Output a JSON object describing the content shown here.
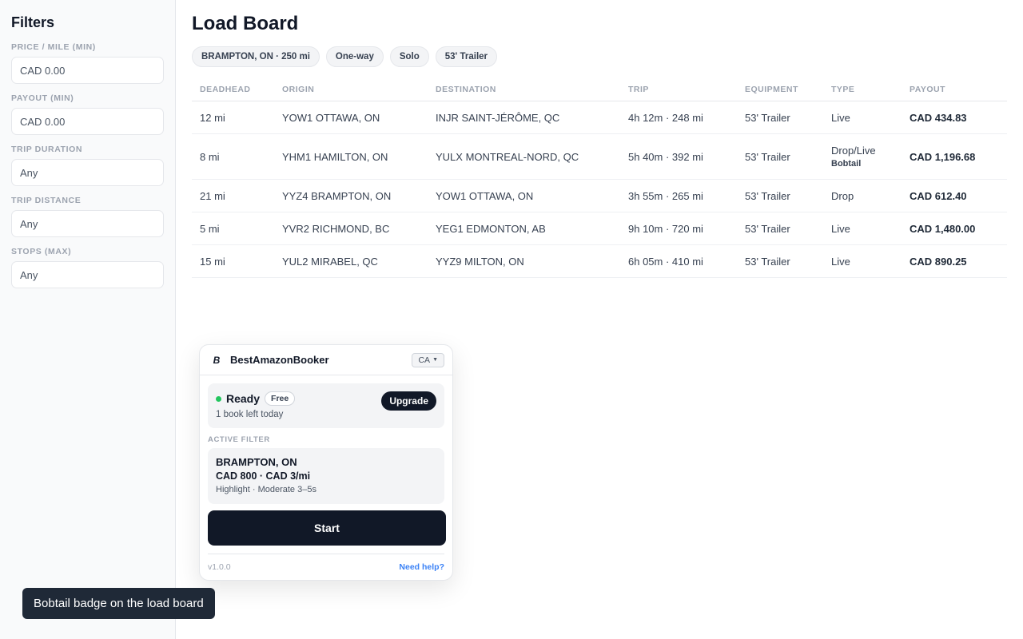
{
  "sidebar": {
    "title": "Filters",
    "filters": [
      {
        "label": "PRICE / MILE (MIN)",
        "value": "CAD 0.00"
      },
      {
        "label": "PAYOUT (MIN)",
        "value": "CAD 0.00"
      },
      {
        "label": "TRIP DURATION",
        "value": "Any"
      },
      {
        "label": "TRIP DISTANCE",
        "value": "Any"
      },
      {
        "label": "STOPS (MAX)",
        "value": "Any"
      }
    ]
  },
  "main": {
    "title": "Load Board",
    "chips": [
      "BRAMPTON, ON · 250 mi",
      "One-way",
      "Solo",
      "53' Trailer"
    ],
    "table": {
      "headers": [
        "DEADHEAD",
        "ORIGIN",
        "DESTINATION",
        "TRIP",
        "EQUIPMENT",
        "TYPE",
        "PAYOUT"
      ],
      "rows": [
        {
          "deadhead": "12 mi",
          "origin": "YOW1 OTTAWA, ON",
          "destination": "INJR SAINT-JÉRÔME, QC",
          "trip": "4h 12m · 248 mi",
          "equipment": "53' Trailer",
          "type": "Live",
          "type_sub": "",
          "payout": "CAD 434.83"
        },
        {
          "deadhead": "8 mi",
          "origin": "YHM1 HAMILTON, ON",
          "destination": "YULX MONTREAL-NORD, QC",
          "trip": "5h 40m · 392 mi",
          "equipment": "53' Trailer",
          "type": "Drop/Live",
          "type_sub": "Bobtail",
          "payout": "CAD 1,196.68"
        },
        {
          "deadhead": "21 mi",
          "origin": "YYZ4 BRAMPTON, ON",
          "destination": "YOW1 OTTAWA, ON",
          "trip": "3h 55m · 265 mi",
          "equipment": "53' Trailer",
          "type": "Drop",
          "type_sub": "",
          "payout": "CAD 612.40"
        },
        {
          "deadhead": "5 mi",
          "origin": "YVR2 RICHMOND, BC",
          "destination": "YEG1 EDMONTON, AB",
          "trip": "9h 10m · 720 mi",
          "equipment": "53' Trailer",
          "type": "Live",
          "type_sub": "",
          "payout": "CAD 1,480.00"
        },
        {
          "deadhead": "15 mi",
          "origin": "YUL2 MIRABEL, QC",
          "destination": "YYZ9 MILTON, ON",
          "trip": "6h 05m · 410 mi",
          "equipment": "53' Trailer",
          "type": "Live",
          "type_sub": "",
          "payout": "CAD 890.25"
        }
      ]
    }
  },
  "popup": {
    "brand_icon": "B",
    "brand_name": "BestAmazonBooker",
    "region": "CA",
    "status": "Ready",
    "status_color": "#22c55e",
    "plan": "Free",
    "books_left": "1 book left today",
    "upgrade_label": "Upgrade",
    "active_filter_label": "ACTIVE FILTER",
    "filter_location": "BRAMPTON, ON",
    "filter_price": "CAD 800 · CAD 3/mi",
    "filter_mode": "Highlight · Moderate 3–5s",
    "start_label": "Start",
    "version": "v1.0.0",
    "help_label": "Need help?"
  },
  "toast": {
    "text": "Bobtail badge on the load board"
  }
}
